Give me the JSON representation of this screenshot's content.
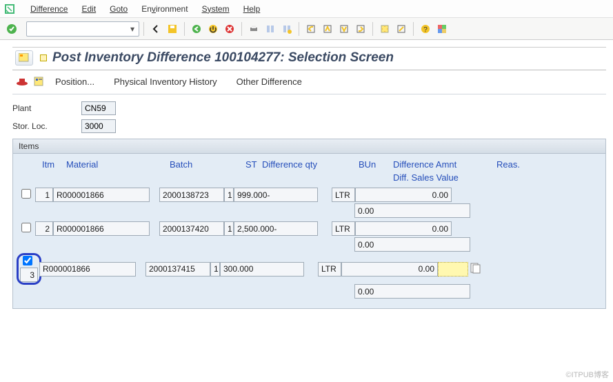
{
  "menu": {
    "difference": "Difference",
    "edit": "Edit",
    "goto": "Goto",
    "environment": "Environment",
    "system": "System",
    "help": "Help"
  },
  "toolbar": {
    "command_value": ""
  },
  "page_title": "Post Inventory Difference 100104277: Selection Screen",
  "actions": {
    "position": "Position...",
    "phys_inv_hist": "Physical Inventory History",
    "other_diff": "Other Difference"
  },
  "fields": {
    "plant_label": "Plant",
    "plant_value": "CN59",
    "plant_desc": "",
    "stloc_label": "Stor. Loc.",
    "stloc_value": "3000",
    "stloc_desc": ""
  },
  "items": {
    "header": "Items",
    "cols": {
      "itm": "Itm",
      "material": "Material",
      "batch": "Batch",
      "st": "ST",
      "diff_qty": "Difference qty",
      "bun": "BUn",
      "diff_amnt": "Difference Amnt",
      "reas": "Reas."
    },
    "sub_col": "Diff. Sales Value",
    "rows": [
      {
        "checked": false,
        "itm": "1",
        "material": "R000001866",
        "batch": "2000138723",
        "st": "1",
        "diff_qty": "999.000-",
        "bun": "LTR",
        "diff_amnt": "0.00",
        "reas": "",
        "diff_sales": "0.00"
      },
      {
        "checked": false,
        "itm": "2",
        "material": "R000001866",
        "batch": "2000137420",
        "st": "1",
        "diff_qty": "2,500.000-",
        "bun": "LTR",
        "diff_amnt": "0.00",
        "reas": "",
        "diff_sales": "0.00"
      },
      {
        "checked": true,
        "itm": "3",
        "material": "R000001866",
        "batch": "2000137415",
        "st": "1",
        "diff_qty": "300.000",
        "bun": "LTR",
        "diff_amnt": "0.00",
        "reas": "",
        "diff_sales": "0.00"
      }
    ]
  },
  "watermark": "©ITPUB博客"
}
